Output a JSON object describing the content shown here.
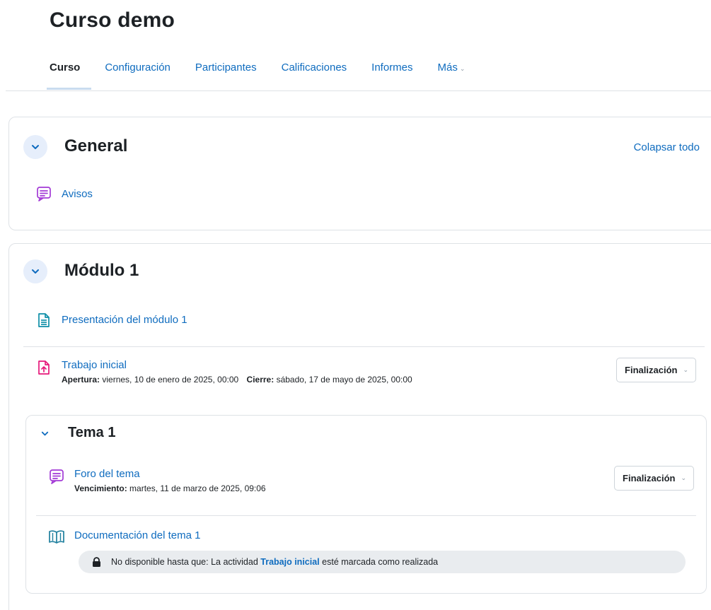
{
  "course": {
    "title": "Curso demo"
  },
  "nav": {
    "tabs": [
      {
        "label": "Curso"
      },
      {
        "label": "Configuración"
      },
      {
        "label": "Participantes"
      },
      {
        "label": "Calificaciones"
      },
      {
        "label": "Informes"
      },
      {
        "label": "Más"
      }
    ]
  },
  "sections": {
    "general": {
      "title": "General",
      "collapse_all": "Colapsar todo",
      "activities": [
        {
          "name": "Avisos",
          "icon": "forum-icon"
        }
      ]
    },
    "modulo1": {
      "title": "Módulo 1",
      "activities": [
        {
          "name": "Presentación del módulo 1",
          "icon": "page-icon"
        },
        {
          "name": "Trabajo inicial",
          "icon": "assignment-icon",
          "open_label": "Apertura:",
          "open_value": "viernes, 10 de enero de 2025, 00:00",
          "close_label": "Cierre:",
          "close_value": "sábado, 17 de mayo de 2025, 00:00",
          "completion": "Finalización"
        }
      ],
      "subsection": {
        "title": "Tema 1",
        "activities": [
          {
            "name": "Foro del tema",
            "icon": "forum-icon",
            "due_label": "Vencimiento:",
            "due_value": "martes, 11 de marzo de 2025, 09:06",
            "completion": "Finalización"
          },
          {
            "name": "Documentación del tema 1",
            "icon": "book-icon",
            "restriction": {
              "prefix": "No disponible hasta que: La actividad",
              "link": "Trabajo inicial",
              "suffix": "esté marcada como realizada"
            }
          }
        ]
      }
    }
  },
  "colors": {
    "link": "#0f6cbf",
    "forum_icon": "#a33ad6",
    "page_icon": "#0f8fa8",
    "assignment_icon": "#e6197a",
    "book_icon": "#1f7f9e"
  }
}
